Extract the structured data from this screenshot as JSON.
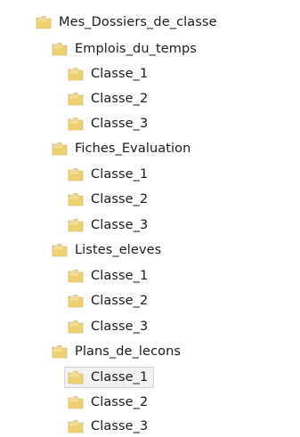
{
  "tree": {
    "root": {
      "label": "Mes_Dossiers_de_classe",
      "icon": "folder-icon"
    },
    "folders": [
      {
        "label": "Emplois_du_temps",
        "icon": "folder-icon",
        "children": [
          {
            "label": "Classe_1",
            "icon": "folder-icon"
          },
          {
            "label": "Classe_2",
            "icon": "folder-icon"
          },
          {
            "label": "Classe_3",
            "icon": "folder-icon"
          }
        ]
      },
      {
        "label": "Fiches_Evaluation",
        "icon": "folder-icon",
        "children": [
          {
            "label": "Classe_1",
            "icon": "folder-icon"
          },
          {
            "label": "Classe_2",
            "icon": "folder-icon"
          },
          {
            "label": "Classe_3",
            "icon": "folder-icon"
          }
        ]
      },
      {
        "label": "Listes_eleves",
        "icon": "folder-icon",
        "children": [
          {
            "label": "Classe_1",
            "icon": "folder-icon"
          },
          {
            "label": "Classe_2",
            "icon": "folder-icon"
          },
          {
            "label": "Classe_3",
            "icon": "folder-icon"
          }
        ]
      },
      {
        "label": "Plans_de_lecons",
        "icon": "folder-icon",
        "children": [
          {
            "label": "Classe_1",
            "icon": "folder-icon",
            "selected": true
          },
          {
            "label": "Classe_2",
            "icon": "folder-icon"
          },
          {
            "label": "Classe_3",
            "icon": "folder-icon"
          }
        ]
      }
    ]
  },
  "colors": {
    "folder_light": "#f6e3a0",
    "folder_mid": "#e9c866",
    "folder_dark": "#c9a040",
    "folder_paper": "#fbf3d6",
    "selection_bg": "#f2f2f2",
    "selection_border": "#d6d6d6"
  }
}
